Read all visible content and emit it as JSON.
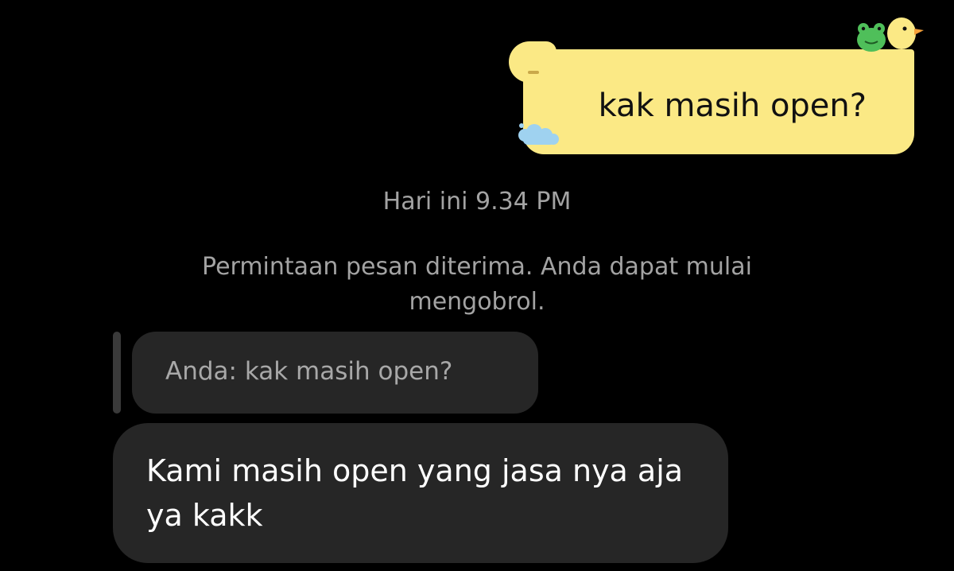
{
  "conversation": {
    "sent_message": "kak masih open?",
    "timestamp": "Hari ini 9.34 PM",
    "system_notice": "Permintaan pesan diterima. Anda dapat mulai mengobrol.",
    "reply_quote": "Anda: kak masih open?",
    "received_message": "Kami masih open yang jasa nya aja ya kakk"
  },
  "theme": {
    "background": "#000000",
    "sent_bubble": "#fbe985",
    "received_bubble": "#262626",
    "muted_text": "#a3a3a3"
  },
  "decorations": {
    "sent_bubble_icons": [
      "duck-icon",
      "frog-icon",
      "cloud-icon"
    ]
  }
}
